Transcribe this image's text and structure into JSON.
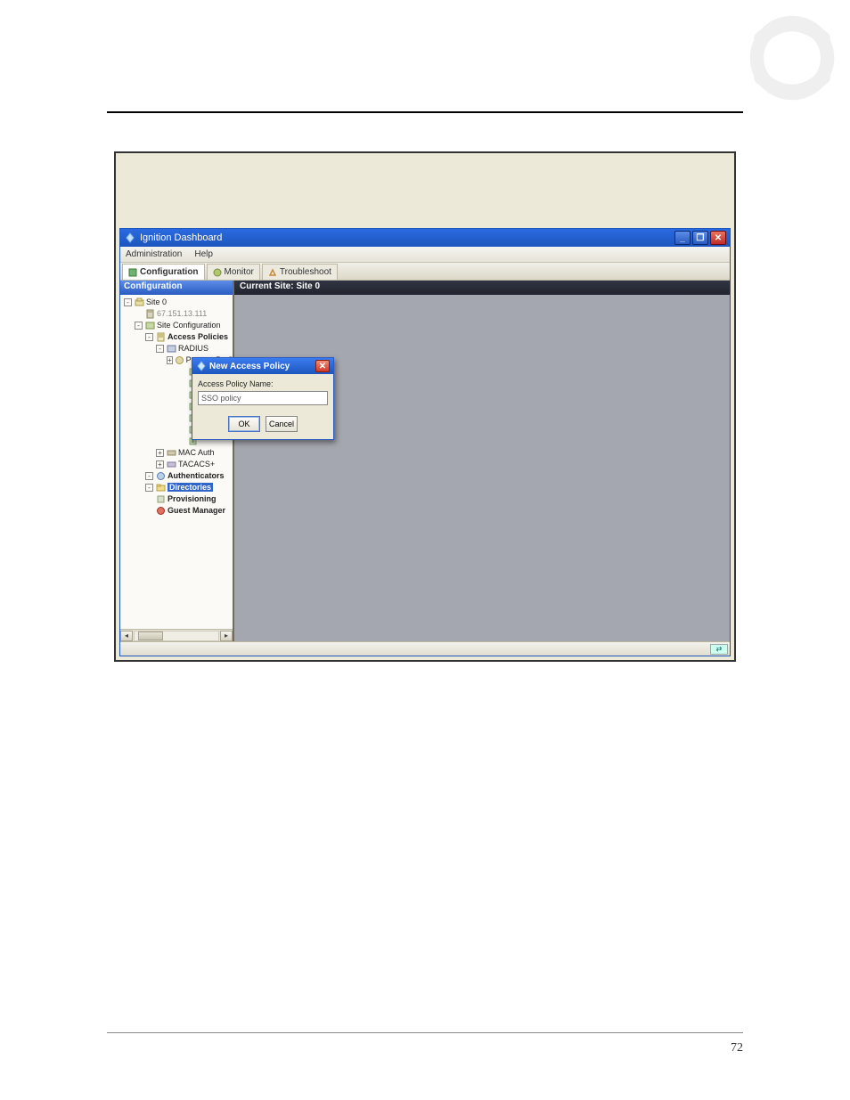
{
  "page": {
    "number": "72"
  },
  "window": {
    "title": "Ignition Dashboard",
    "menus": [
      "Administration",
      "Help"
    ],
    "tabs": [
      {
        "icon": "config-icon",
        "label": "Configuration",
        "active": true
      },
      {
        "icon": "monitor-icon",
        "label": "Monitor",
        "active": false
      },
      {
        "icon": "troubleshoot-icon",
        "label": "Troubleshoot",
        "active": false
      }
    ],
    "controls": {
      "min": "_",
      "max": "❐",
      "close": "✕"
    }
  },
  "sidebar": {
    "title": "Configuration",
    "nodes": [
      {
        "indent": 0,
        "expander": "-",
        "icon": "site-icon",
        "label": "Site 0",
        "bold": false
      },
      {
        "indent": 1,
        "expander": "",
        "icon": "server-icon",
        "label": "67.151.13.111",
        "bold": false,
        "dim": true
      },
      {
        "indent": 1,
        "expander": "-",
        "icon": "siteconf-icon",
        "label": "Site Configuration",
        "bold": false
      },
      {
        "indent": 2,
        "expander": "-",
        "icon": "policies-icon",
        "label": "Access Policies",
        "bold": true
      },
      {
        "indent": 3,
        "expander": "-",
        "icon": "policy-icon",
        "label": "RADIUS",
        "bold": false
      },
      {
        "indent": 4,
        "expander": "+",
        "icon": "profile-icon",
        "label": "Posture Profiles",
        "bold": false
      },
      {
        "indent": 5,
        "expander": "",
        "icon": "chip-icon",
        "label": "",
        "bold": false
      },
      {
        "indent": 5,
        "expander": "",
        "icon": "chip-icon",
        "label": "",
        "bold": false
      },
      {
        "indent": 5,
        "expander": "",
        "icon": "chip-icon",
        "label": "",
        "bold": false
      },
      {
        "indent": 5,
        "expander": "",
        "icon": "chip-icon",
        "label": "",
        "bold": false
      },
      {
        "indent": 5,
        "expander": "",
        "icon": "chip-icon",
        "label": "",
        "bold": false
      },
      {
        "indent": 5,
        "expander": "",
        "icon": "chip-icon",
        "label": "",
        "bold": false
      },
      {
        "indent": 5,
        "expander": "",
        "icon": "chip-icon",
        "label": "",
        "bold": false
      },
      {
        "indent": 3,
        "expander": "+",
        "icon": "mac-icon",
        "label": "MAC Auth",
        "bold": false
      },
      {
        "indent": 3,
        "expander": "+",
        "icon": "tacacs-icon",
        "label": "TACACS+",
        "bold": false
      },
      {
        "indent": 2,
        "expander": "-",
        "icon": "auth-icon",
        "label": "Authenticators",
        "bold": true
      },
      {
        "indent": 2,
        "expander": "-",
        "icon": "dir-icon",
        "label": "Directories",
        "bold": true,
        "selected": true
      },
      {
        "indent": 2,
        "expander": "",
        "icon": "prov-icon",
        "label": "Provisioning",
        "bold": true
      },
      {
        "indent": 2,
        "expander": "",
        "icon": "guest-icon",
        "label": "Guest Manager",
        "bold": true
      }
    ]
  },
  "main": {
    "title": "Current Site: Site 0"
  },
  "dialog": {
    "title": "New Access Policy",
    "label": "Access Policy Name:",
    "input_value": "SSO policy",
    "ok": "OK",
    "cancel": "Cancel",
    "close": "✕"
  }
}
